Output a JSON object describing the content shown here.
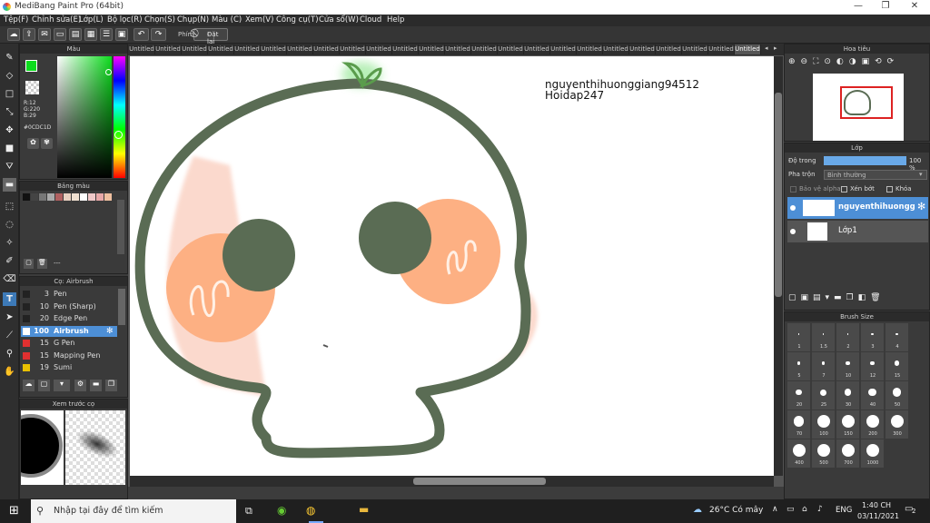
{
  "window": {
    "title": "MediBang Paint Pro (64bit)",
    "min": "—",
    "restore": "❐",
    "close": "✕"
  },
  "menu": [
    "Tệp(F)",
    "Chỉnh sửa(E)",
    "Lớp(L)",
    "Bộ lọc(R)",
    "Chọn(S)",
    "Chụp(N)",
    "Màu (C)",
    "Xem(V)",
    "Công cụ(T)",
    "Cửa sổ(W)",
    "Cloud",
    "Help"
  ],
  "toolbar": {
    "hotkey_label": "Phím",
    "reset_label": "Đặt lại"
  },
  "tabs": [
    "Untitled",
    "Untitled",
    "Untitled",
    "Untitled",
    "Untitled",
    "Untitled",
    "Untitled",
    "Untitled",
    "Untitled",
    "Untitled",
    "Untitled",
    "Untitled",
    "Untitled",
    "Untitled",
    "Untitled",
    "Untitled",
    "Untitled",
    "Untitled",
    "Untitled",
    "Untitled",
    "Untitled",
    "Untitled",
    "Untitled",
    "Untitled"
  ],
  "color_panel": {
    "title": "Màu",
    "r": "R:12",
    "g": "G:220",
    "b": "B:29",
    "hex": "#0CDC1D",
    "current_color": "#0cdc1d"
  },
  "palette_panel": {
    "title": "Bảng màu",
    "swatches": [
      "#111111",
      "#444444",
      "#777777",
      "#aaaaaa",
      "#b06060",
      "#e8d0c0",
      "#f0e0d0",
      "#ffffff",
      "#f0c8c8",
      "#e8a8a8",
      "#f0c0a0"
    ],
    "dash": "---"
  },
  "brush_panel": {
    "title": "Cọ: Airbrush",
    "items": [
      {
        "size": "3",
        "name": "Pen",
        "color": "#222222"
      },
      {
        "size": "10",
        "name": "Pen (Sharp)",
        "color": "#222222"
      },
      {
        "size": "20",
        "name": "Edge Pen",
        "color": "#222222"
      },
      {
        "size": "100",
        "name": "Airbrush",
        "color": "#ffffff",
        "selected": true
      },
      {
        "size": "15",
        "name": "G Pen",
        "color": "#e03030"
      },
      {
        "size": "15",
        "name": "Mapping Pen",
        "color": "#e03030"
      },
      {
        "size": "19",
        "name": "Sumi",
        "color": "#e8c000"
      }
    ]
  },
  "preview_panel": {
    "title": "Xem trước cọ"
  },
  "canvas": {
    "watermark_line1": "nguyenthihuonggiang94512",
    "watermark_line2": "Hoidap247"
  },
  "navigator": {
    "title": "Hoa tiêu"
  },
  "layers": {
    "title": "Lớp",
    "opacity_label": "Độ trong",
    "opacity_value": "100 %",
    "opacity_fraction": 1.0,
    "blend_label": "Pha trộn",
    "blend_value": "Bình thường",
    "protect_alpha": "Bảo vệ alpha",
    "clipping": "Xén bớt",
    "lock": "Khóa",
    "items": [
      {
        "name": "nguyenthihuongg",
        "selected": true
      },
      {
        "name": "Lớp1",
        "selected": false
      }
    ]
  },
  "brush_size": {
    "title": "Brush Size",
    "sizes": [
      "1",
      "1.5",
      "2",
      "3",
      "4",
      "5",
      "7",
      "10",
      "12",
      "15",
      "20",
      "25",
      "30",
      "40",
      "50",
      "70",
      "100",
      "150",
      "200",
      "300",
      "400",
      "500",
      "700",
      "1000"
    ]
  },
  "taskbar": {
    "search": "Nhập tại đây để tìm kiếm",
    "weather": "26°C Có mây",
    "lang": "ENG",
    "time": "1:40 CH",
    "date": "03/11/2021",
    "notif": "2"
  }
}
